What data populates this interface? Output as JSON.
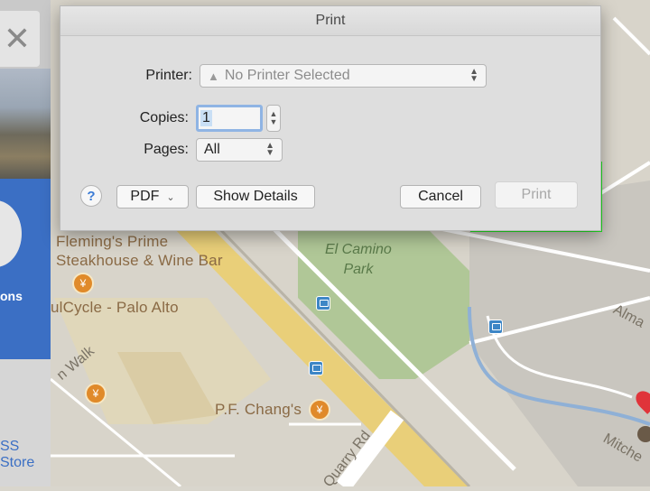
{
  "window_title": "Print",
  "printer": {
    "label": "Printer:",
    "value": "No Printer Selected",
    "icon": "warning-icon"
  },
  "copies": {
    "label": "Copies:",
    "value": "1"
  },
  "pages": {
    "label": "Pages:",
    "value": "All"
  },
  "buttons": {
    "help": "?",
    "pdf": "PDF",
    "show_details": "Show Details",
    "cancel": "Cancel",
    "print": "Print"
  },
  "highlight_color": "#22e622",
  "sidebar": {
    "close": "✕",
    "blue_label": "ons",
    "store_label": "SS Store",
    "accent": "#3b6fc4"
  },
  "map": {
    "places": [
      "Fleming's Prime",
      "Steakhouse & Wine Bar",
      "ulCycle - Palo Alto",
      "P.F. Chang's"
    ],
    "park": [
      "El Camino",
      "Park"
    ],
    "roads": [
      "n Walk",
      "Quarry Rd",
      "Alma",
      "Mitche"
    ]
  }
}
